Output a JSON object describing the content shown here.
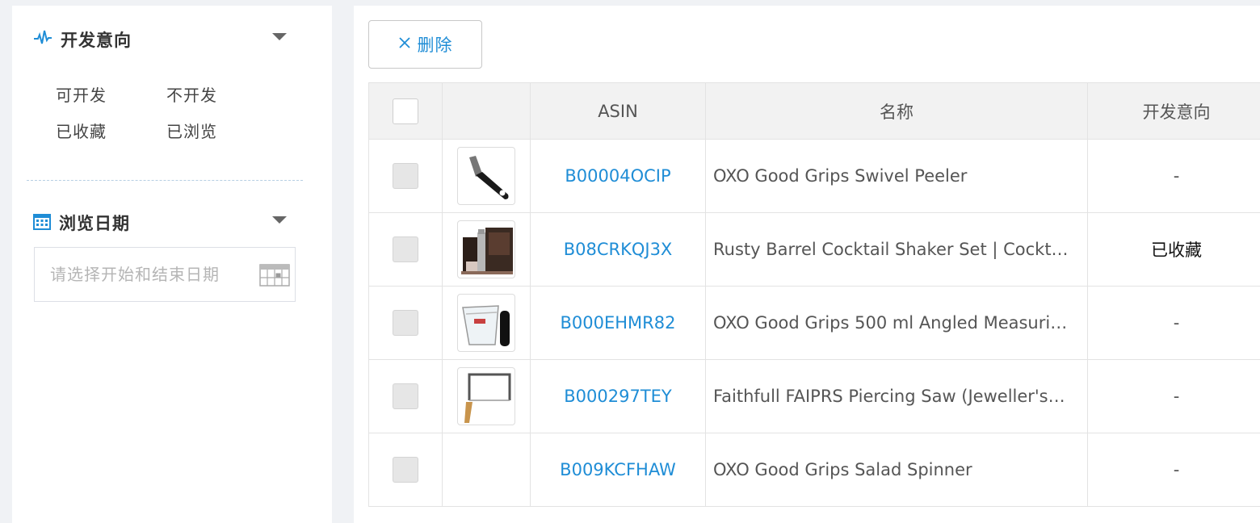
{
  "sidebar": {
    "intent_section": {
      "title": "开发意向",
      "icon": "pulse-icon"
    },
    "intent_options": [
      "可开发",
      "不开发",
      "已收藏",
      "已浏览"
    ],
    "date_section": {
      "title": "浏览日期",
      "icon": "calendar-icon"
    },
    "date_placeholder": "请选择开始和结束日期"
  },
  "toolbar": {
    "delete_label": "删除"
  },
  "table": {
    "headers": {
      "asin": "ASIN",
      "name": "名称",
      "intent": "开发意向"
    },
    "rows": [
      {
        "asin": "B00004OCIP",
        "name": "OXO Good Grips Swivel Peeler",
        "intent": "-",
        "thumb": "peeler-thumbnail"
      },
      {
        "asin": "B08CRKQJ3X",
        "name": "Rusty Barrel Cocktail Shaker Set | Cockt…",
        "intent": "已收藏",
        "thumb": "cocktail-set-thumbnail"
      },
      {
        "asin": "B000EHMR82",
        "name": "OXO Good Grips 500 ml Angled Measuri…",
        "intent": "-",
        "thumb": "measuring-cup-thumbnail"
      },
      {
        "asin": "B000297TEY",
        "name": "Faithfull FAIPRS Piercing Saw (Jeweller's…",
        "intent": "-",
        "thumb": "saw-thumbnail"
      },
      {
        "asin": "B009KCFHAW",
        "name": "OXO Good Grips Salad Spinner",
        "intent": "-",
        "thumb": ""
      }
    ]
  },
  "colors": {
    "link": "#1f8dd6",
    "header_bg": "#f2f2f2",
    "page_bg": "#f0f2f5"
  }
}
